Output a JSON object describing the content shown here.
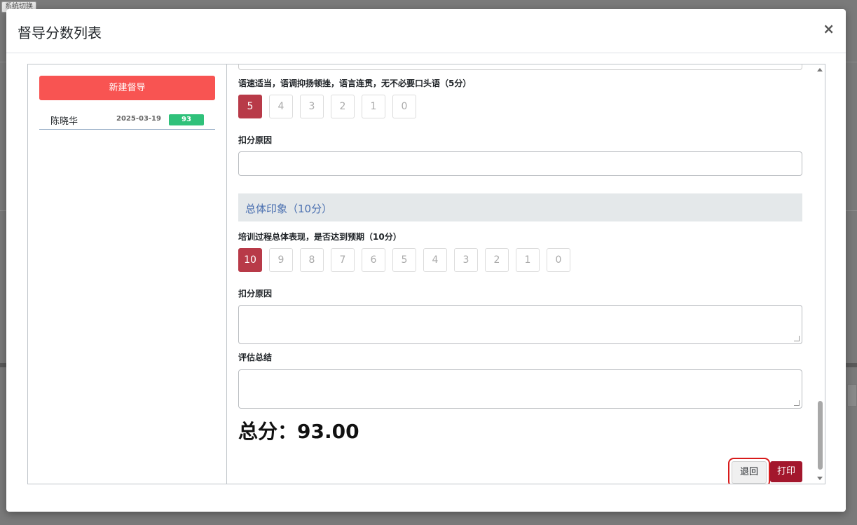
{
  "background": {
    "tab_label": "系统切换"
  },
  "modal": {
    "title": "督导分数列表",
    "close_symbol": "×"
  },
  "left": {
    "new_button": "新建督导",
    "records": [
      {
        "name": "陈晓华",
        "date": "2025-03-19",
        "score": "93"
      }
    ]
  },
  "right": {
    "q1": {
      "label": "语速适当，语调抑扬顿挫，语言连贯，无不必要口头语（5分）",
      "options": [
        "5",
        "4",
        "3",
        "2",
        "1",
        "0"
      ],
      "selected": "5"
    },
    "deduct_label_1": "扣分原因",
    "section_title": "总体印象（10分）",
    "q2": {
      "label": "培训过程总体表现，是否达到预期（10分）",
      "options": [
        "10",
        "9",
        "8",
        "7",
        "6",
        "5",
        "4",
        "3",
        "2",
        "1",
        "0"
      ],
      "selected": "10"
    },
    "deduct_label_2": "扣分原因",
    "summary_label": "评估总结",
    "total": "总分：93.00",
    "back_button": "退回",
    "print_button": "打印"
  },
  "colors": {
    "selected_score": "#b83a48",
    "new_button": "#f85452",
    "badge": "#2fc17a",
    "print_button": "#a3172d",
    "highlight_box": "#d81b1b"
  }
}
